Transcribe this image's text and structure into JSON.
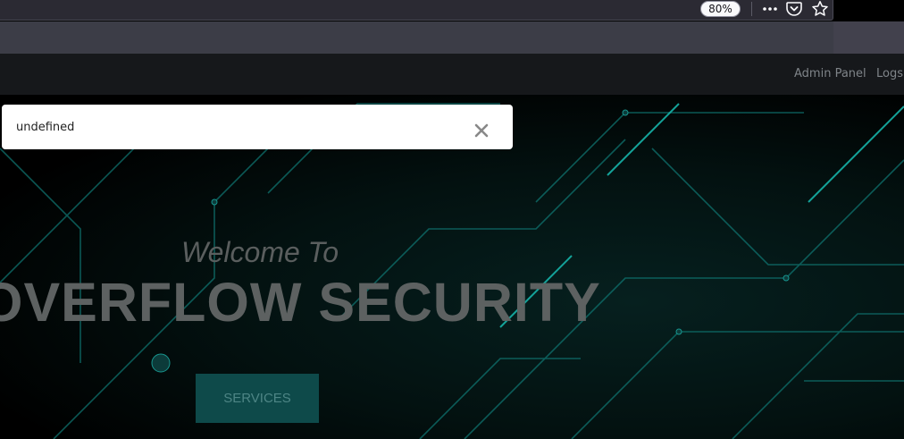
{
  "browser": {
    "zoom_level": "80%",
    "icons": [
      "more-icon",
      "pocket-icon",
      "bookmark-star-icon"
    ]
  },
  "navbar": {
    "links": [
      "Admin Panel",
      "Logs"
    ]
  },
  "hero": {
    "welcome": "Welcome To",
    "brand": "OVERFLOW SECURITY",
    "button_label": "SERVICES"
  },
  "toast": {
    "message": "undefined",
    "close_icon": "close-icon"
  },
  "colors": {
    "accent": "#0e4a4a",
    "circuit": "#1fa8a0"
  }
}
